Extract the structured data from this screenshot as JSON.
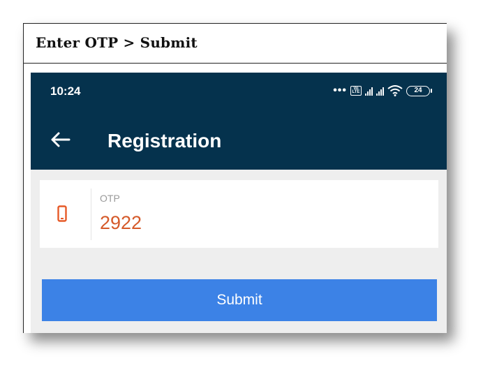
{
  "caption": {
    "text": "Enter OTP > Submit"
  },
  "status_bar": {
    "time": "10:24",
    "dots": "•••",
    "volte": "Vo LTE",
    "battery": "24",
    "icons": [
      "volte-icon",
      "signal-icon",
      "signal-icon",
      "wifi-icon",
      "battery-icon"
    ]
  },
  "app_bar": {
    "back_icon": "back-arrow-icon",
    "title": "Registration",
    "background": "#05324d"
  },
  "otp_field": {
    "icon": "phone-icon",
    "label": "OTP",
    "value": "2922",
    "value_color": "#d55a2a"
  },
  "submit_button": {
    "label": "Submit",
    "color": "#3c82e6"
  }
}
